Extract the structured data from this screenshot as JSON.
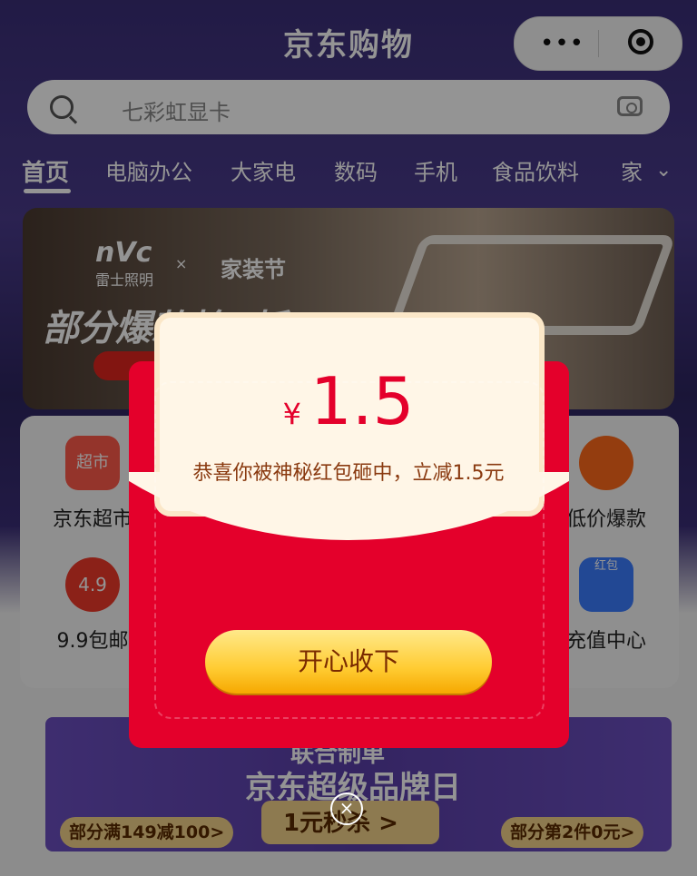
{
  "header": {
    "title": "京东购物",
    "more_icon": "•••",
    "target_icon": "record-icon"
  },
  "search": {
    "placeholder": "七彩虹显卡"
  },
  "tabs": [
    {
      "label": "首页"
    },
    {
      "label": "电脑办公"
    },
    {
      "label": "大家电"
    },
    {
      "label": "数码"
    },
    {
      "label": "手机"
    },
    {
      "label": "食品饮料"
    },
    {
      "label": "家"
    }
  ],
  "banner": {
    "brand": "nVc",
    "brand_sub": "雷士照明",
    "x": "×",
    "festival": "家装节",
    "headline": "部分爆款抢5折"
  },
  "categories": [
    {
      "label": "京东超市",
      "icon_label": "超市"
    },
    {
      "label": "低价爆款",
      "icon_label": ""
    },
    {
      "label": "9.9包邮",
      "icon_label": "4.9"
    },
    {
      "label": "充值中心",
      "icon_label": "红包"
    }
  ],
  "promo": {
    "title_top": "联合制单",
    "title": "京东超级品牌日",
    "left_tag": "部分满149减100>",
    "mid_tag": "1元秒杀 >",
    "right_tag": "部分第2件0元>"
  },
  "modal": {
    "currency": "¥",
    "amount": "1.5",
    "message": "恭喜你被神秘红包砸中，立减1.5元",
    "button": "开心收下",
    "close": "×"
  }
}
